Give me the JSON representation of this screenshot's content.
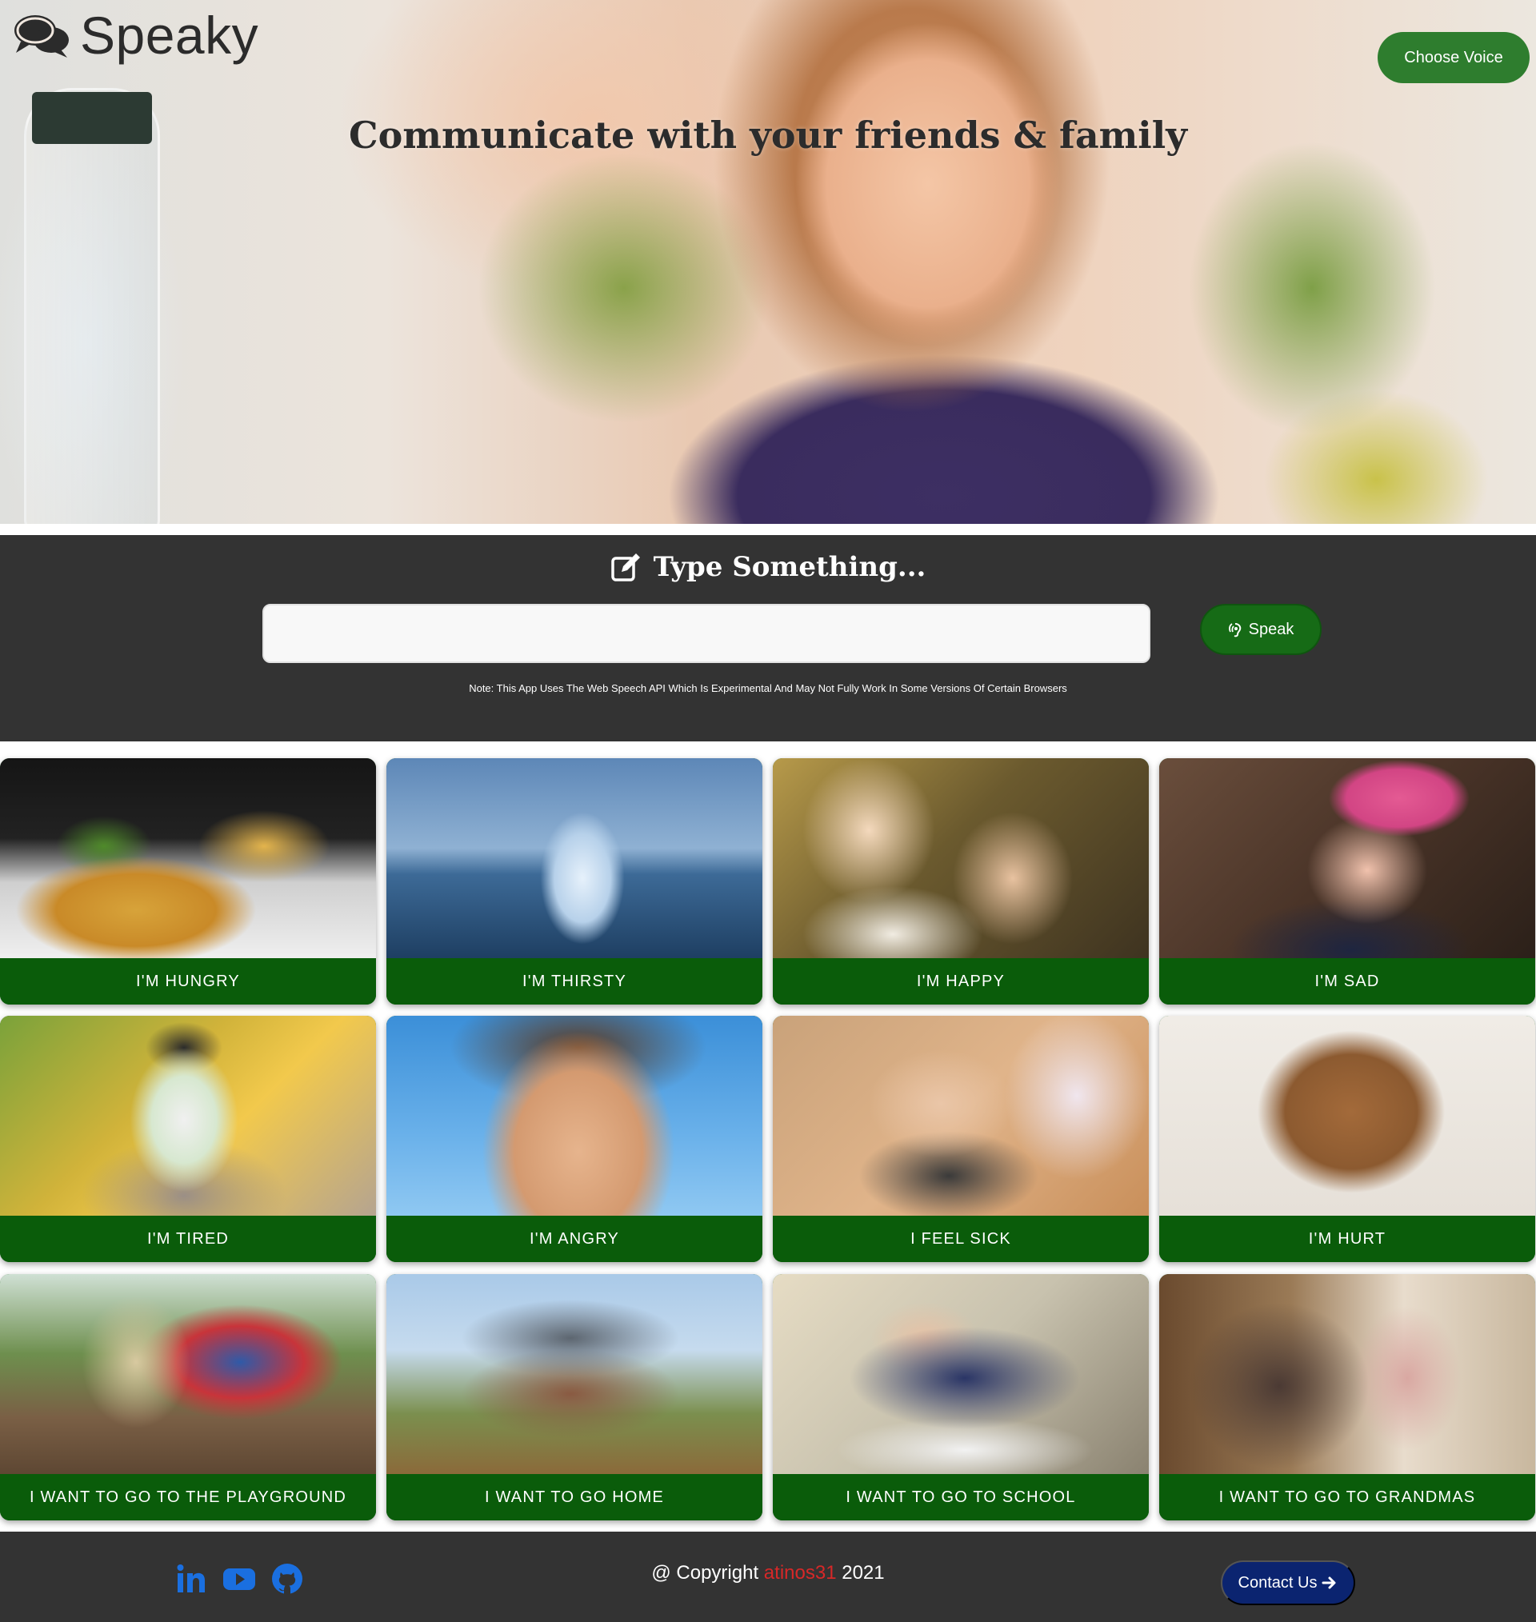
{
  "brand": {
    "name": "Speaky",
    "icon": "comments-icon"
  },
  "header": {
    "choose_voice_label": "Choose Voice"
  },
  "hero": {
    "title": "Communicate with your friends & family"
  },
  "typer": {
    "heading": "Type Something...",
    "heading_icon": "edit-icon",
    "input_value": "",
    "input_placeholder": "",
    "speak_label": "Speak",
    "speak_icon": "speech-icon",
    "note": "Note: This App Uses The Web Speech API Which Is Experimental And May Not Fully Work In Some Versions Of Certain Browsers"
  },
  "cards": [
    {
      "label": "I'M HUNGRY",
      "image": "pizza"
    },
    {
      "label": "I'M THIRSTY",
      "image": "water glass"
    },
    {
      "label": "I'M HAPPY",
      "image": "two smiling children"
    },
    {
      "label": "I'M SAD",
      "image": "crying child"
    },
    {
      "label": "I'M TIRED",
      "image": "yawning child"
    },
    {
      "label": "I'M ANGRY",
      "image": "frowning boy"
    },
    {
      "label": "I FEEL SICK",
      "image": "sick child in bed"
    },
    {
      "label": "I'M HURT",
      "image": "bandaged teddy bear"
    },
    {
      "label": "I WANT TO GO TO THE PLAYGROUND",
      "image": "playground"
    },
    {
      "label": "I WANT TO GO HOME",
      "image": "house"
    },
    {
      "label": "I WANT TO GO TO SCHOOL",
      "image": "classroom"
    },
    {
      "label": "I WANT TO GO TO GRANDMAS",
      "image": "grandmother with child"
    }
  ],
  "footer": {
    "social": [
      "linkedin-icon",
      "youtube-icon",
      "github-icon"
    ],
    "copyright_prefix": "@ Copyright",
    "copyright_author": "atinos31",
    "copyright_year": "2021",
    "contact_label": "Contact Us"
  },
  "colors": {
    "primary_green": "#0a5c0a",
    "button_green": "#2e7d2e",
    "dark_bg": "#333333",
    "contact_blue": "#0b2470",
    "social_blue": "#1a6fe0",
    "author_red": "#d62828"
  }
}
